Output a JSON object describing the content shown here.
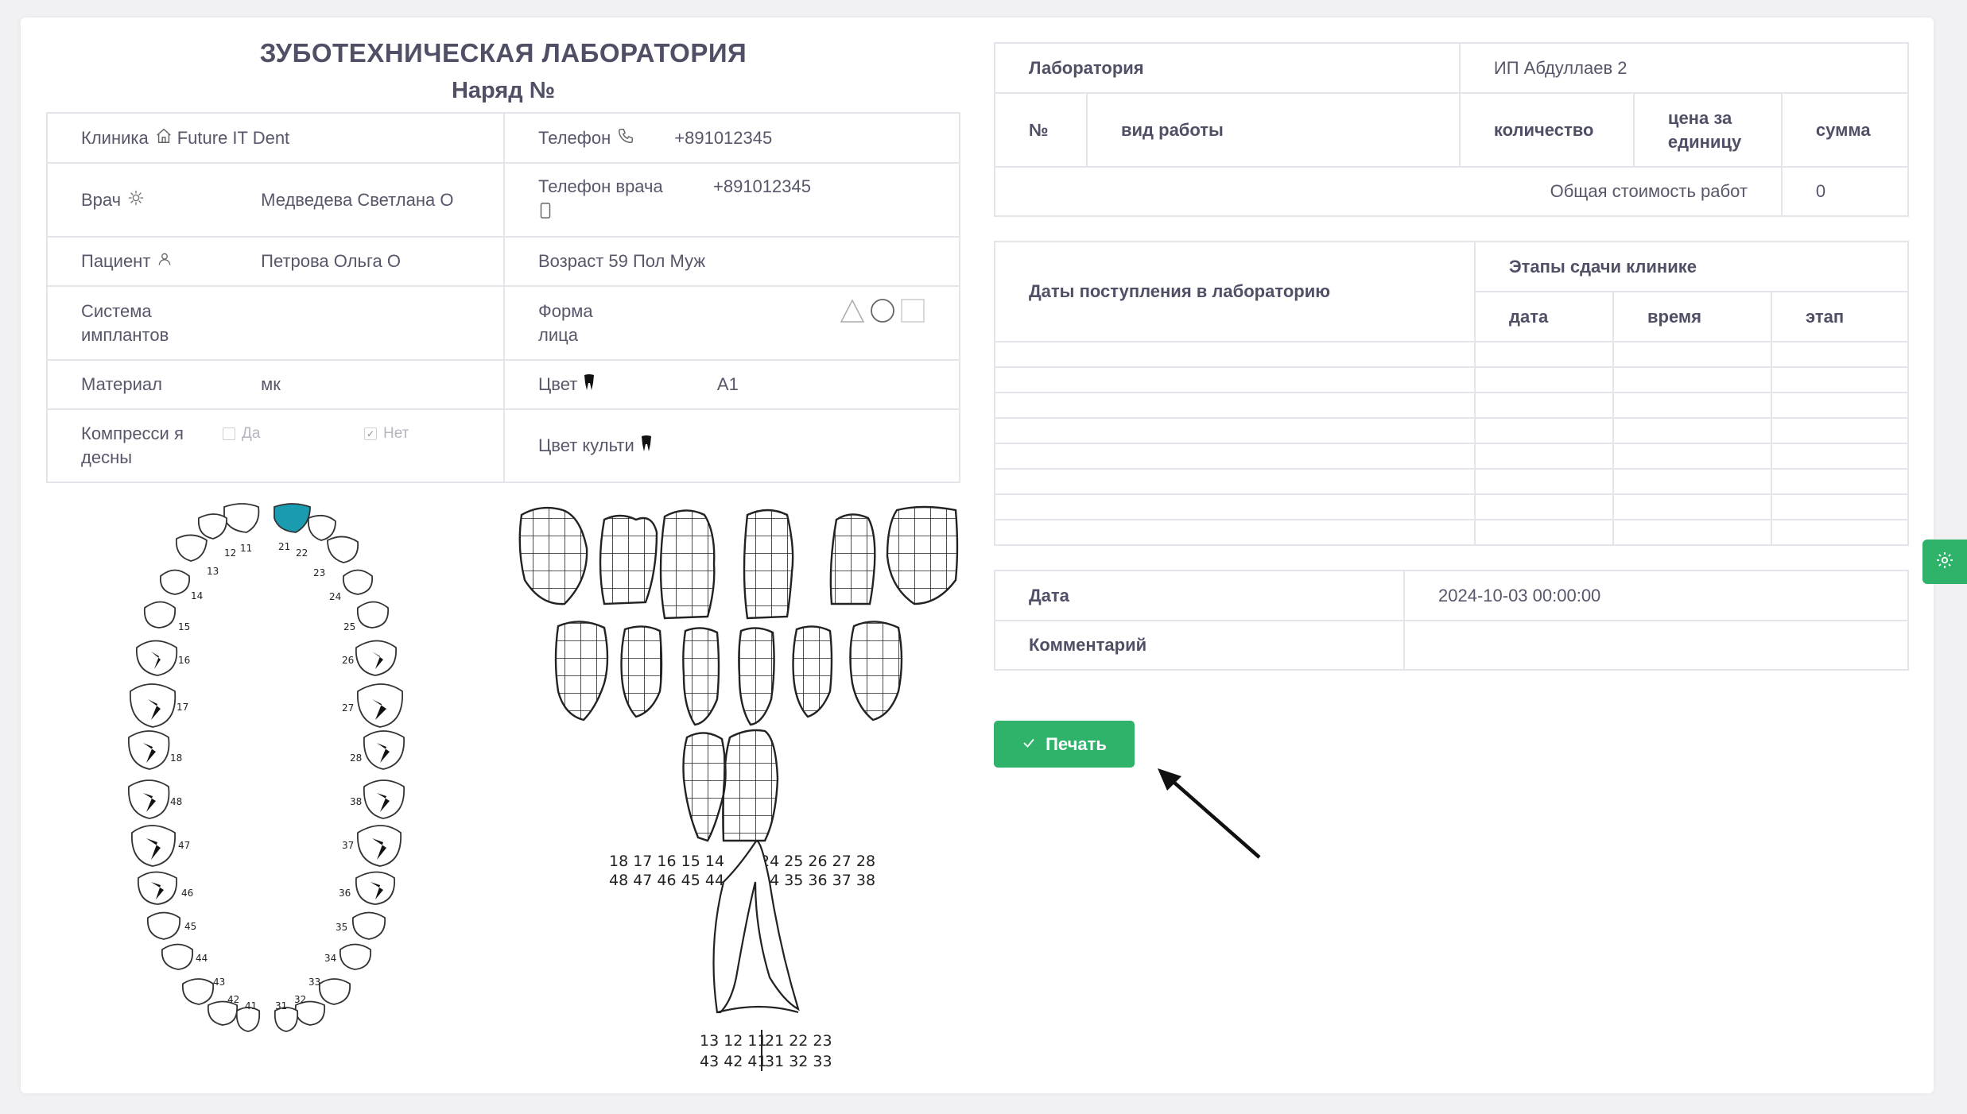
{
  "header": {
    "title": "ЗУБОТЕХНИЧЕСКАЯ ЛАБОРАТОРИЯ",
    "subtitle": "Наряд №"
  },
  "info": {
    "clinic_label": "Клиника",
    "clinic_value": "Future IT Dent",
    "phone_label": "Телефон",
    "phone_value": "+891012345",
    "doctor_label": "Врач",
    "doctor_value": "Медведева Светлана О",
    "doctor_phone_label": "Телефон врача",
    "doctor_phone_value": "+891012345",
    "patient_label": "Пациент",
    "patient_value": "Петрова Ольга О",
    "age_gender": "Возраст 59 Пол Муж",
    "implant_label": "Система имплантов",
    "face_label": "Форма лица",
    "material_label": "Материал",
    "material_value": "мк",
    "color_label": "Цвет",
    "color_value": "A1",
    "compression_label": "Компресси я десны",
    "compression_yes": "Да",
    "compression_no": "Нет",
    "compression_no_checked": true,
    "stump_color_label": "Цвет культи"
  },
  "work_table": {
    "lab_label": "Лаборатория",
    "lab_value": "ИП Абдуллаев 2",
    "columns": [
      "№",
      "вид работы",
      "количество",
      "цена за единицу",
      "сумма"
    ],
    "total_label": "Общая стоимость работ",
    "total_value": "0"
  },
  "dates_table": {
    "receipt_label": "Даты поступления в лабораторию",
    "stages_label": "Этапы сдачи клинике",
    "columns": [
      "дата",
      "время",
      "этап"
    ],
    "empty_rows": 8
  },
  "meta_table": {
    "date_label": "Дата",
    "date_value": "2024-10-03 00:00:00",
    "comment_label": "Комментарий",
    "comment_value": ""
  },
  "actions": {
    "print_label": "Печать"
  },
  "teeth": {
    "selected_tooth": "21",
    "selected_color": "#1a9bb0",
    "upper_left_numbers": [
      "11",
      "12",
      "13",
      "14",
      "15",
      "16",
      "17",
      "18"
    ],
    "upper_right_numbers": [
      "21",
      "22",
      "23",
      "24",
      "25",
      "26",
      "27",
      "28"
    ],
    "lower_left_numbers": [
      "48",
      "47",
      "46",
      "45",
      "44",
      "43",
      "42",
      "41"
    ],
    "lower_right_numbers": [
      "38",
      "37",
      "36",
      "35",
      "34",
      "33",
      "32",
      "31"
    ],
    "grid_row1": "18 17 16 15 14",
    "grid_row1_right": "24 25 26 27 28",
    "grid_row2": "48 47 46 45 44",
    "grid_row2_right": "34 35 36 37 38",
    "front_row1": "13 12 11",
    "front_row1_right": "21 22 23",
    "front_row2": "43 42 41",
    "front_row2_right": "31 32 33"
  }
}
